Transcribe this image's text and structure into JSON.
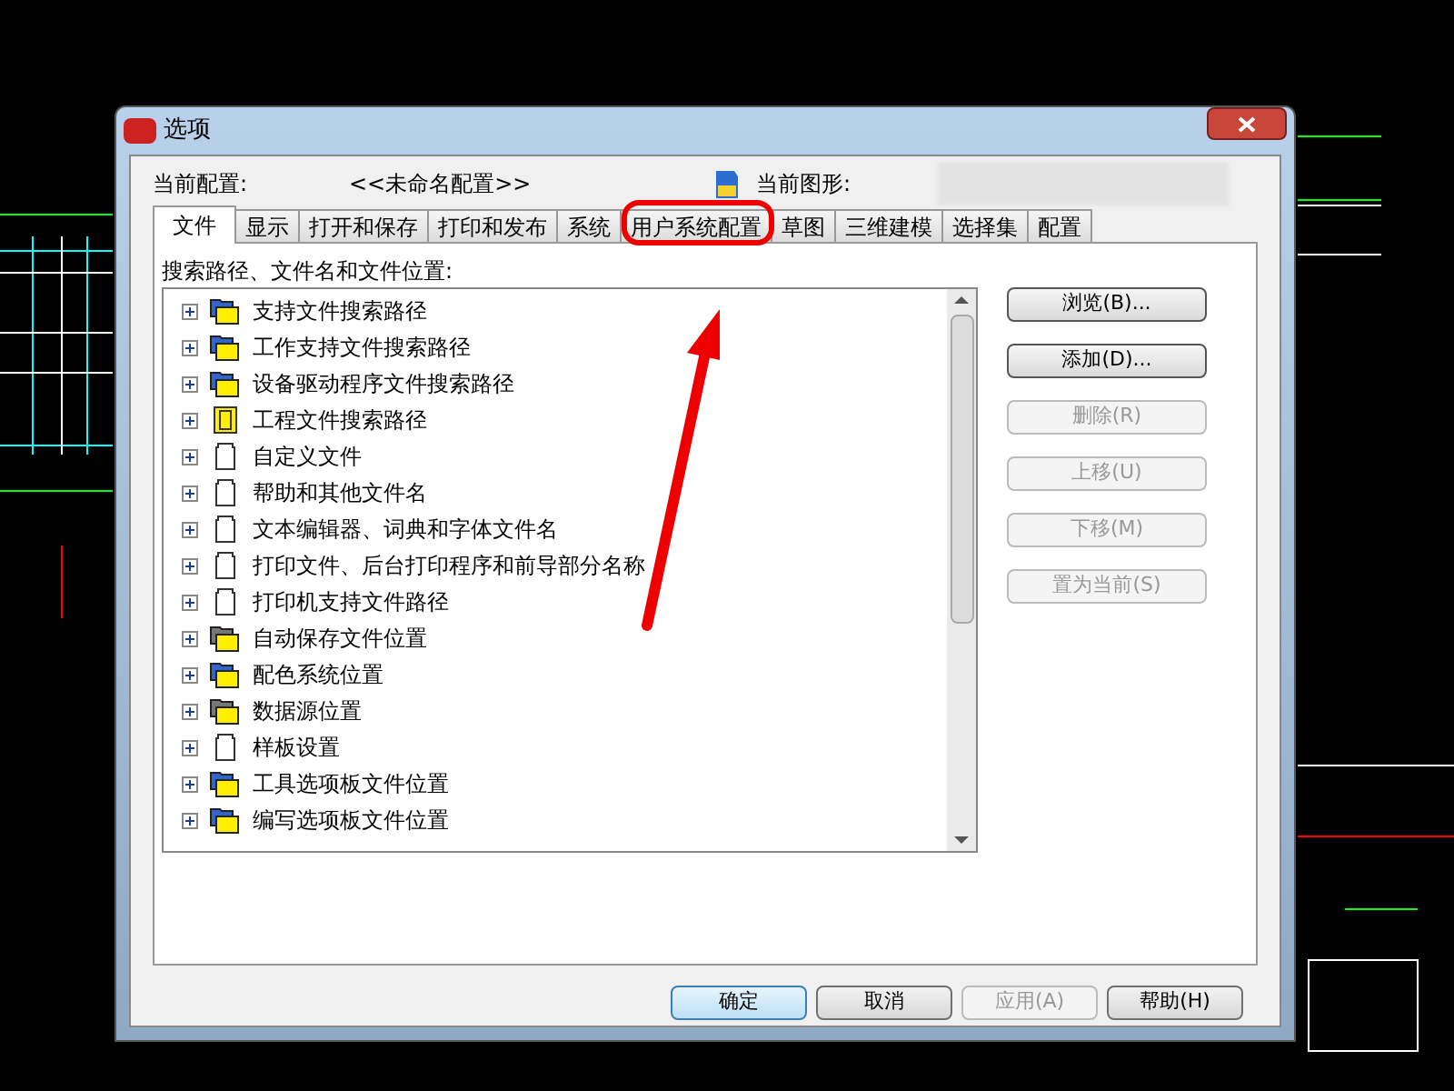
{
  "window": {
    "title": "选项"
  },
  "profile": {
    "current_profile_label": "当前配置:",
    "current_profile": "<<未命名配置>>",
    "current_drawing_label": "当前图形:"
  },
  "tabs": [
    {
      "label": "文件",
      "selected": true
    },
    {
      "label": "显示",
      "selected": false
    },
    {
      "label": "打开和保存",
      "selected": false
    },
    {
      "label": "打印和发布",
      "selected": false
    },
    {
      "label": "系统",
      "selected": false
    },
    {
      "label": "用户系统配置",
      "selected": false
    },
    {
      "label": "草图",
      "selected": false
    },
    {
      "label": "三维建模",
      "selected": false
    },
    {
      "label": "选择集",
      "selected": false
    },
    {
      "label": "配置",
      "selected": false
    }
  ],
  "tree": {
    "label": "搜索路径、文件名和文件位置:",
    "items": [
      {
        "label": "支持文件搜索路径",
        "kind": "folder",
        "expanded": false
      },
      {
        "label": "工作支持文件搜索路径",
        "kind": "folder",
        "expanded": false
      },
      {
        "label": "设备驱动程序文件搜索路径",
        "kind": "folder",
        "expanded": false
      },
      {
        "label": "工程文件搜索路径",
        "kind": "project",
        "expanded": false
      },
      {
        "label": "自定义文件",
        "kind": "file",
        "expanded": false
      },
      {
        "label": "帮助和其他文件名",
        "kind": "file",
        "expanded": false
      },
      {
        "label": "文本编辑器、词典和字体文件名",
        "kind": "file",
        "expanded": false
      },
      {
        "label": "打印文件、后台打印程序和前导部分名称",
        "kind": "file",
        "expanded": false
      },
      {
        "label": "打印机支持文件路径",
        "kind": "file",
        "expanded": false
      },
      {
        "label": "自动保存文件位置",
        "kind": "folder_dark",
        "expanded": false
      },
      {
        "label": "配色系统位置",
        "kind": "folder",
        "expanded": false
      },
      {
        "label": "数据源位置",
        "kind": "folder_dark",
        "expanded": false
      },
      {
        "label": "样板设置",
        "kind": "file",
        "expanded": false
      },
      {
        "label": "工具选项板文件位置",
        "kind": "folder",
        "expanded": false
      },
      {
        "label": "编写选项板文件位置",
        "kind": "folder",
        "expanded": false
      }
    ]
  },
  "side_buttons": [
    {
      "label": "浏览(B)...",
      "disabled": false
    },
    {
      "label": "添加(D)...",
      "disabled": false
    },
    {
      "label": "删除(R)",
      "disabled": true
    },
    {
      "label": "上移(U)",
      "disabled": true
    },
    {
      "label": "下移(M)",
      "disabled": true
    },
    {
      "label": "置为当前(S)",
      "disabled": true
    }
  ],
  "footer_buttons": [
    {
      "label": "确定",
      "disabled": false,
      "default": true
    },
    {
      "label": "取消",
      "disabled": false,
      "default": false
    },
    {
      "label": "应用(A)",
      "disabled": true,
      "default": false
    },
    {
      "label": "帮助(H)",
      "disabled": false,
      "default": false
    }
  ]
}
